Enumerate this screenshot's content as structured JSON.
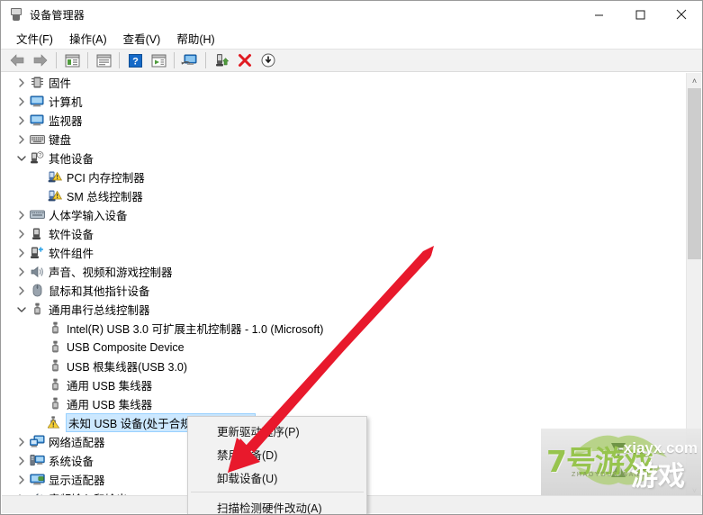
{
  "window": {
    "title": "设备管理器",
    "icon": "device-manager-icon",
    "minimize_label": "─",
    "maximize_label": "□",
    "close_label": "✕"
  },
  "menubar": {
    "items": [
      {
        "label": "文件(F)",
        "name": "menu-file"
      },
      {
        "label": "操作(A)",
        "name": "menu-action"
      },
      {
        "label": "查看(V)",
        "name": "menu-view"
      },
      {
        "label": "帮助(H)",
        "name": "menu-help"
      }
    ]
  },
  "toolbar": {
    "buttons": [
      {
        "icon": "back-arrow-icon"
      },
      {
        "icon": "forward-arrow-icon"
      },
      {
        "icon": "show-hide-console-tree-icon"
      },
      {
        "icon": "properties-icon"
      },
      {
        "icon": "help-icon"
      },
      {
        "icon": "update-driver-icon"
      },
      {
        "icon": "scan-hardware-changes-icon"
      },
      {
        "icon": "enable-device-icon"
      },
      {
        "icon": "uninstall-device-icon"
      },
      {
        "icon": "download-icon"
      }
    ]
  },
  "tree": {
    "rows": [
      {
        "label": "固件",
        "indent": 1,
        "chevron": "collapsed",
        "icon": "firmware-icon",
        "selected": false
      },
      {
        "label": "计算机",
        "indent": 1,
        "chevron": "collapsed",
        "icon": "computer-icon",
        "selected": false
      },
      {
        "label": "监视器",
        "indent": 1,
        "chevron": "collapsed",
        "icon": "monitor-icon",
        "selected": false
      },
      {
        "label": "键盘",
        "indent": 1,
        "chevron": "collapsed",
        "icon": "keyboard-icon",
        "selected": false
      },
      {
        "label": "其他设备",
        "indent": 1,
        "chevron": "expanded",
        "icon": "other-devices-icon",
        "selected": false
      },
      {
        "label": "PCI 内存控制器",
        "indent": 2,
        "chevron": "none",
        "icon": "warning-device-icon",
        "selected": false
      },
      {
        "label": "SM 总线控制器",
        "indent": 2,
        "chevron": "none",
        "icon": "warning-device-icon",
        "selected": false
      },
      {
        "label": "人体学输入设备",
        "indent": 1,
        "chevron": "collapsed",
        "icon": "hid-icon",
        "selected": false
      },
      {
        "label": "软件设备",
        "indent": 1,
        "chevron": "collapsed",
        "icon": "software-device-icon",
        "selected": false
      },
      {
        "label": "软件组件",
        "indent": 1,
        "chevron": "collapsed",
        "icon": "software-component-icon",
        "selected": false
      },
      {
        "label": "声音、视频和游戏控制器",
        "indent": 1,
        "chevron": "collapsed",
        "icon": "sound-icon",
        "selected": false
      },
      {
        "label": "鼠标和其他指针设备",
        "indent": 1,
        "chevron": "collapsed",
        "icon": "mouse-icon",
        "selected": false
      },
      {
        "label": "通用串行总线控制器",
        "indent": 1,
        "chevron": "expanded",
        "icon": "usb-icon",
        "selected": false
      },
      {
        "label": "Intel(R) USB 3.0 可扩展主机控制器 - 1.0 (Microsoft)",
        "indent": 2,
        "chevron": "none",
        "icon": "usb-icon",
        "selected": false
      },
      {
        "label": "USB Composite Device",
        "indent": 2,
        "chevron": "none",
        "icon": "usb-icon",
        "selected": false
      },
      {
        "label": "USB 根集线器(USB 3.0)",
        "indent": 2,
        "chevron": "none",
        "icon": "usb-icon",
        "selected": false
      },
      {
        "label": "通用 USB 集线器",
        "indent": 2,
        "chevron": "none",
        "icon": "usb-icon",
        "selected": false
      },
      {
        "label": "通用 USB 集线器",
        "indent": 2,
        "chevron": "none",
        "icon": "usb-icon",
        "selected": false
      },
      {
        "label": "未知 USB 设备(处于合规模式的链接)",
        "indent": 2,
        "chevron": "none",
        "icon": "warning-usb-icon",
        "selected": true
      },
      {
        "label": "网络适配器",
        "indent": 1,
        "chevron": "collapsed",
        "icon": "network-adapter-icon",
        "selected": false
      },
      {
        "label": "系统设备",
        "indent": 1,
        "chevron": "collapsed",
        "icon": "system-device-icon",
        "selected": false
      },
      {
        "label": "显示适配器",
        "indent": 1,
        "chevron": "collapsed",
        "icon": "display-adapter-icon",
        "selected": false
      },
      {
        "label": "音频输入和输出",
        "indent": 1,
        "chevron": "collapsed",
        "icon": "audio-io-icon",
        "selected": false
      }
    ]
  },
  "context_menu": {
    "items": [
      {
        "label": "更新驱动程序(P)",
        "name": "ctx-update-driver"
      },
      {
        "label": "禁用设备(D)",
        "name": "ctx-disable-device"
      },
      {
        "label": "卸载设备(U)",
        "name": "ctx-uninstall-device"
      },
      {
        "separator": true
      },
      {
        "label": "扫描检测硬件改动(A)",
        "name": "ctx-scan-hardware-changes"
      }
    ]
  },
  "scrollbar": {
    "up_glyph": "˄",
    "down_glyph": "˅"
  },
  "annotation": {
    "arrow_color": "#e8192c",
    "points_at": "卸载设备(U)"
  },
  "watermark": {
    "text_cn": "7号游戏",
    "text_site": "-xiayx.com",
    "text_pinyin": "ZHAOYOUXIWANG",
    "text_cn2": "游戏",
    "accent": "#8fbf3f"
  }
}
